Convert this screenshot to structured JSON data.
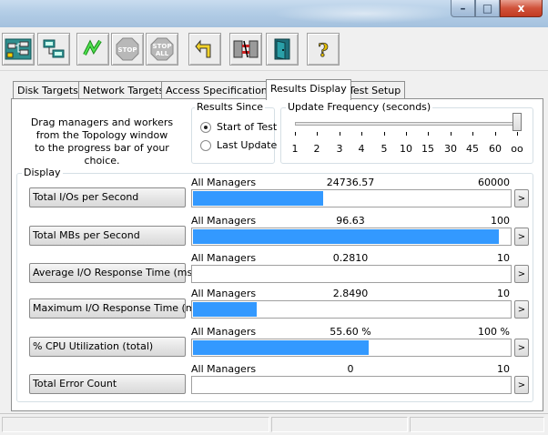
{
  "window": {
    "buttons": {
      "minimize": "–",
      "maximize": "□",
      "close": "x"
    }
  },
  "toolbar": {
    "buttons": [
      {
        "name": "topology-icon"
      },
      {
        "name": "network-icon"
      },
      {
        "name": "start-tests-icon"
      },
      {
        "name": "stop-icon",
        "label": "STOP"
      },
      {
        "name": "stop-all-icon",
        "label1": "STOP",
        "label2": "ALL"
      },
      {
        "name": "reset-workers-icon"
      },
      {
        "name": "disconnect-icon"
      },
      {
        "name": "exit-icon"
      },
      {
        "name": "help-icon",
        "label": "?"
      }
    ]
  },
  "tabs": [
    {
      "label": "Disk Targets",
      "active": false
    },
    {
      "label": "Network Targets",
      "active": false
    },
    {
      "label": "Access Specifications",
      "active": false
    },
    {
      "label": "Results Display",
      "active": true
    },
    {
      "label": "Test Setup",
      "active": false
    }
  ],
  "hint": {
    "line1": "Drag managers and workers",
    "line2": "from the Topology window",
    "line3": "to the progress bar of your choice."
  },
  "results_since": {
    "title": "Results Since",
    "options": [
      {
        "label": "Start of Test",
        "checked": true
      },
      {
        "label": "Last Update",
        "checked": false
      }
    ]
  },
  "update_frequency": {
    "title": "Update Frequency (seconds)",
    "ticks": [
      "1",
      "2",
      "3",
      "4",
      "5",
      "10",
      "15",
      "30",
      "45",
      "60",
      "oo"
    ],
    "selected_index": 10
  },
  "display": {
    "title": "Display",
    "more_symbol": ">",
    "metrics": [
      {
        "button": "Total I/Os per Second",
        "source": "All Managers",
        "value": "24736.57",
        "max": "60000",
        "fill": 0.412
      },
      {
        "button": "Total MBs per Second",
        "source": "All Managers",
        "value": "96.63",
        "max": "100",
        "fill": 0.9663
      },
      {
        "button": "Average I/O Response Time (ms)",
        "source": "All Managers",
        "value": "0.2810",
        "max": "10",
        "fill": 0.0
      },
      {
        "button": "Maximum I/O Response Time (ms)",
        "source": "All Managers",
        "value": "2.8490",
        "max": "10",
        "fill": 0.2
      },
      {
        "button": "% CPU Utilization (total)",
        "source": "All Managers",
        "value": "55.60 %",
        "max": "100 %",
        "fill": 0.556
      },
      {
        "button": "Total Error Count",
        "source": "All Managers",
        "value": "0",
        "max": "10",
        "fill": 0.0
      }
    ]
  },
  "colors": {
    "bar_fill": "#3399ff",
    "panel": "#ffffff",
    "chrome": "#f0f0f0"
  }
}
